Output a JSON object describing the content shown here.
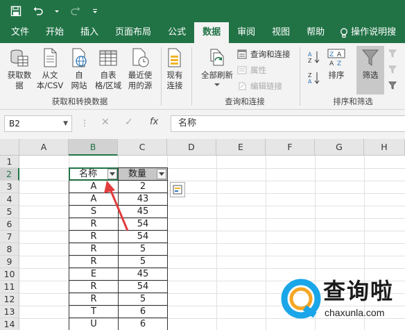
{
  "tabs": [
    "文件",
    "开始",
    "插入",
    "页面布局",
    "公式",
    "数据",
    "审阅",
    "视图",
    "帮助"
  ],
  "tab_search": "操作说明搜",
  "ribbon": {
    "get_transform": {
      "btn_get_data": "获取数\n据",
      "btn_text_csv": "从文\n本/CSV",
      "btn_web": "自\n网站",
      "btn_table": "自表\n格/区域",
      "btn_recent": "最近使\n用的源",
      "label": "获取和转换数据"
    },
    "existing": {
      "btn": "现有\n连接"
    },
    "queries": {
      "btn_refresh_all": "全部刷新",
      "queries_connections": "查询和连接",
      "properties": "属性",
      "edit_links": "编辑链接",
      "label": "查询和连接"
    },
    "sort_filter": {
      "btn_sort": "排序",
      "btn_filter": "筛选",
      "label": "排序和筛选"
    }
  },
  "formula_bar": {
    "name_box": "B2",
    "fx": "fx",
    "content": "名称"
  },
  "columns": [
    "A",
    "B",
    "C",
    "D",
    "E",
    "F",
    "G",
    "H"
  ],
  "rows": [
    "1",
    "2",
    "3",
    "4",
    "5",
    "6",
    "7",
    "8",
    "9",
    "10",
    "11",
    "12",
    "13",
    "14"
  ],
  "table": {
    "headers": [
      "名称",
      "数量"
    ],
    "rows": [
      [
        "A",
        "2"
      ],
      [
        "A",
        "43"
      ],
      [
        "S",
        "45"
      ],
      [
        "R",
        "54"
      ],
      [
        "R",
        "54"
      ],
      [
        "R",
        "5"
      ],
      [
        "R",
        "5"
      ],
      [
        "E",
        "45"
      ],
      [
        "R",
        "54"
      ],
      [
        "R",
        "5"
      ],
      [
        "T",
        "6"
      ],
      [
        "U",
        "6"
      ]
    ]
  },
  "watermark": {
    "title": "查询啦",
    "url": "chaxunla.com"
  },
  "colors": {
    "excel_green": "#217346",
    "arrow_red": "#e23c3c",
    "logo_blue": "#1aa6e8",
    "logo_orange": "#f5a623"
  }
}
